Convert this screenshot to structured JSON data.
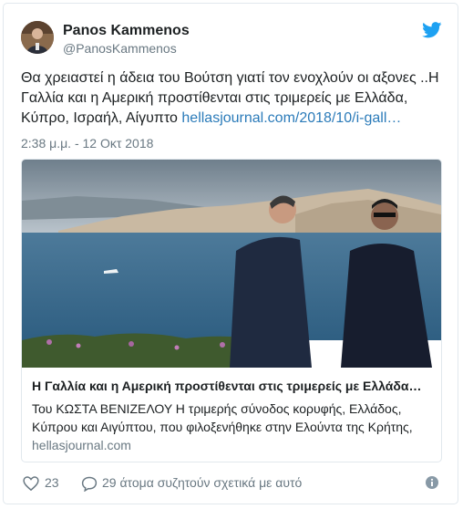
{
  "author": {
    "name": "Panos Kammenos",
    "handle": "@PanosKammenos"
  },
  "tweet": {
    "text": "Θα χρειαστεί η άδεια του Βούτση γιατί τον ενοχλούν οι αξονες ..Η Γαλλία και η Αμερική προστίθενται στις τριμερείς με Ελλάδα, Κύπρο, Ισραήλ, Αίγυπτο",
    "link": "hellasjournal.com/2018/10/i-gall…",
    "timestamp": "2:38 μ.μ. - 12 Οκτ 2018"
  },
  "preview": {
    "title": "Η Γαλλία και η Αμερική προστίθενται στις τριμερείς με Ελλάδα…",
    "description": "Του ΚΩΣΤΑ ΒΕΝΙΖΕΛΟΥ Η τριμερής σύνοδος κορυφής, Ελλάδος, Κύπρου και Αιγύπτου, που φιλοξενήθηκε στην Ελούντα της Κρήτης,",
    "domain": "hellasjournal.com"
  },
  "footer": {
    "likes": "23",
    "replies_text": "29 άτομα συζητούν σχετικά με αυτό"
  },
  "colors": {
    "twitter_blue": "#1da1f2",
    "link": "#2b7bb9",
    "muted": "#697882",
    "sea": "#3d6a8c"
  },
  "icons": {
    "brand": "twitter-bird-icon",
    "like": "heart-icon",
    "reply": "speech-bubble-icon",
    "info": "info-icon"
  }
}
